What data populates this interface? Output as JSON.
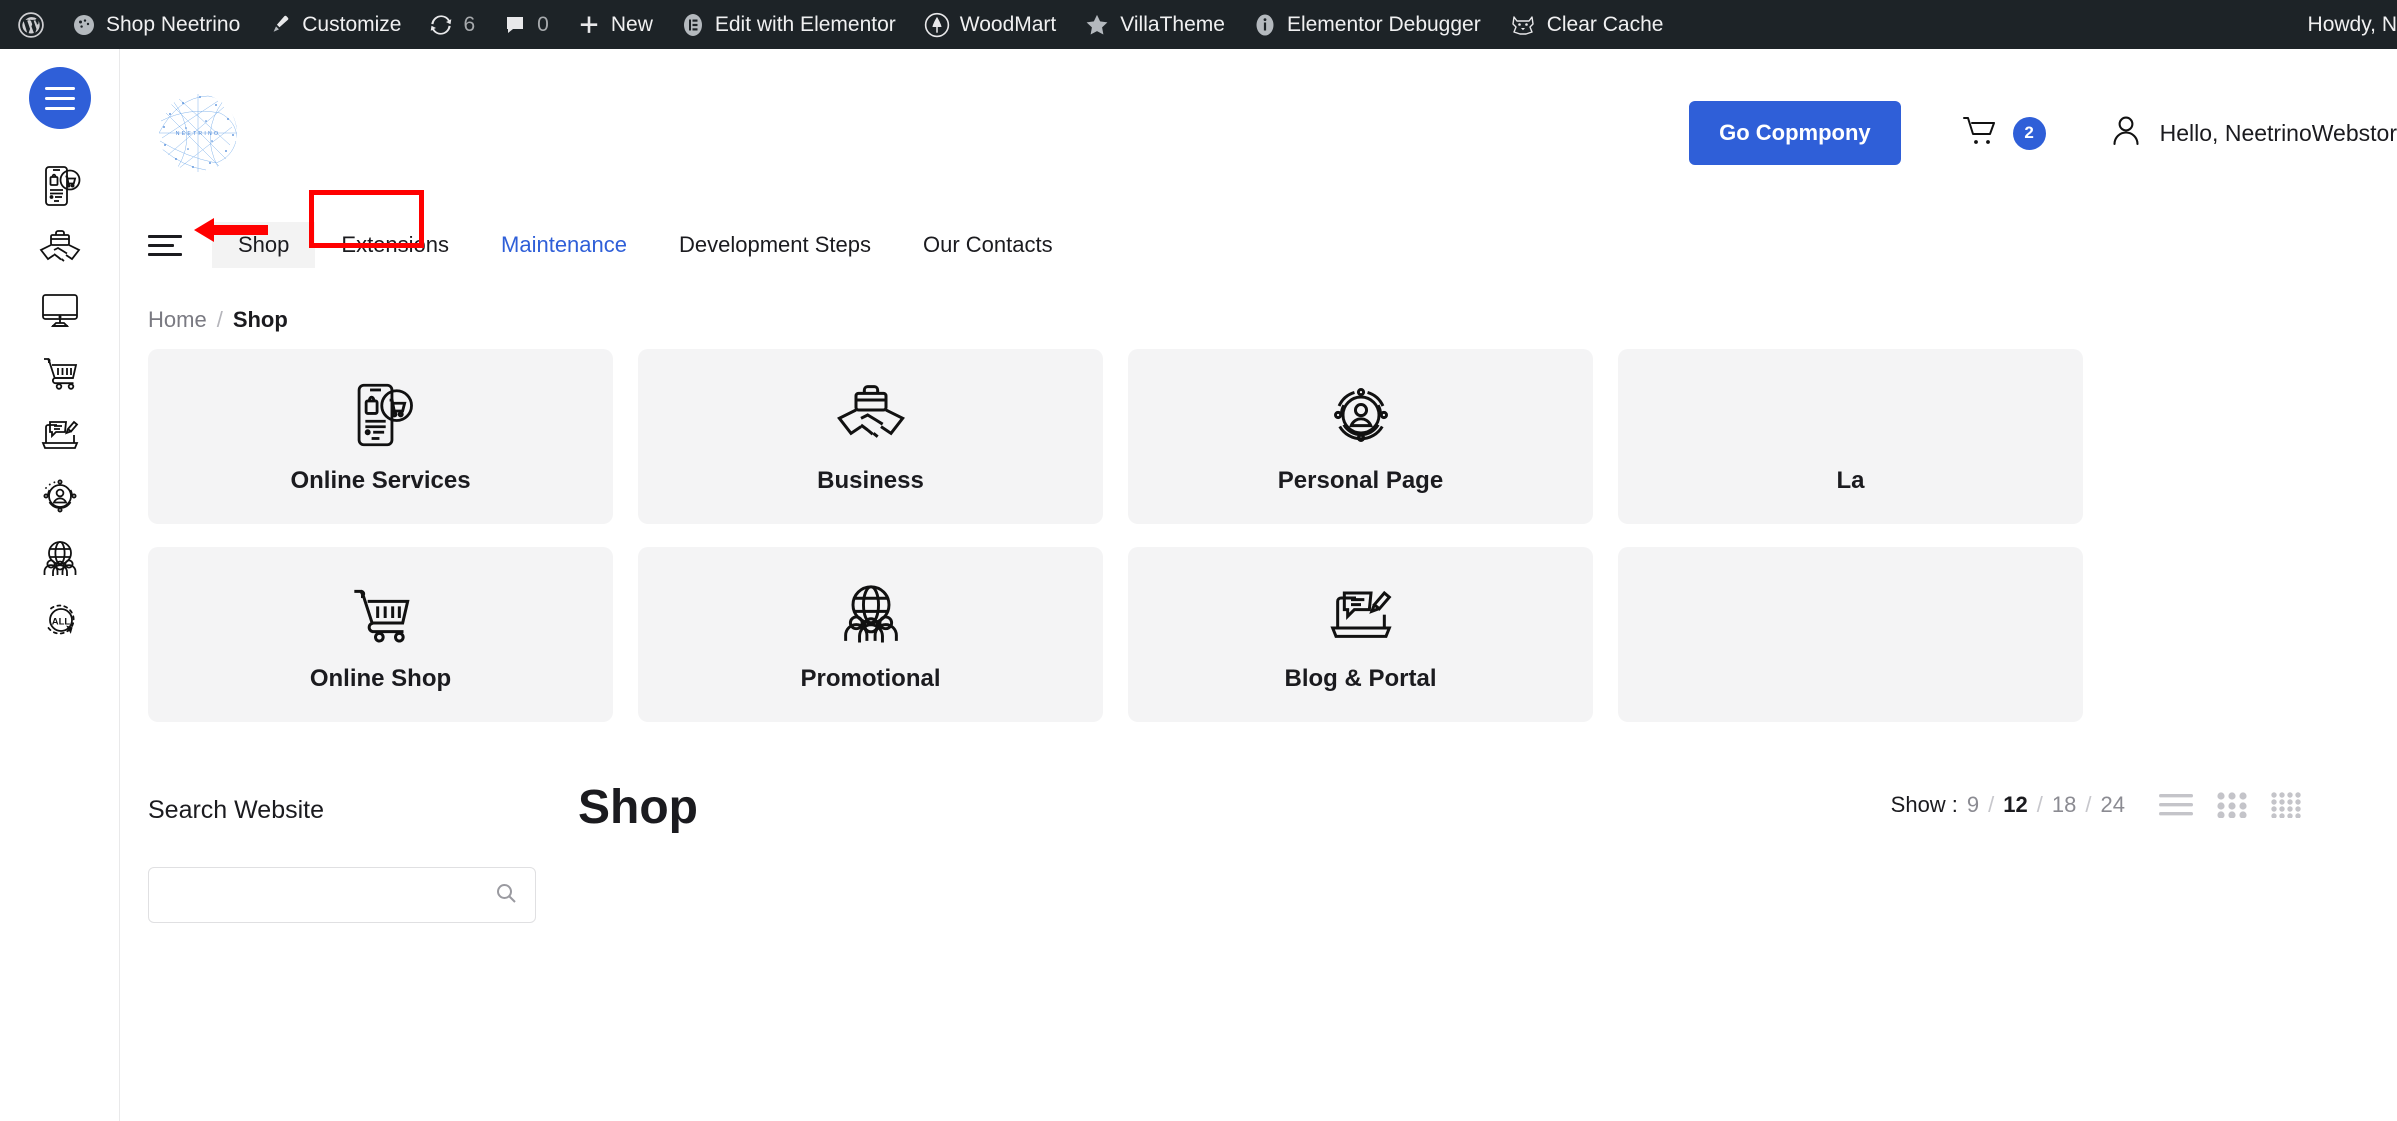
{
  "adminbar": {
    "items": [
      {
        "label": "",
        "icon": "wordpress-logo-icon"
      },
      {
        "label": "Shop Neetrino",
        "icon": "site-dashboard-icon"
      },
      {
        "label": "Customize",
        "icon": "paintbrush-icon"
      },
      {
        "label": "6",
        "icon": "updates-icon"
      },
      {
        "label": "0",
        "icon": "comment-bubble-icon"
      },
      {
        "label": "New",
        "icon": "plus-icon"
      },
      {
        "label": "Edit with Elementor",
        "icon": "elementor-icon"
      },
      {
        "label": "WoodMart",
        "icon": "woodmart-icon"
      },
      {
        "label": "VillaTheme",
        "icon": "star-icon"
      },
      {
        "label": "Elementor Debugger",
        "icon": "info-icon"
      },
      {
        "label": "Clear Cache",
        "icon": "cat-icon"
      }
    ],
    "howdy": "Howdy, N"
  },
  "rail": {
    "menu_toggle_name": "hamburger-menu-button",
    "icons": [
      {
        "name": "mobile-commerce-icon",
        "title": "Online Services"
      },
      {
        "name": "handshake-briefcase-icon",
        "title": "Business"
      },
      {
        "name": "desktop-monitor-icon",
        "title": "Landing"
      },
      {
        "name": "shopping-cart-icon",
        "title": "Online Shop"
      },
      {
        "name": "blog-writing-icon",
        "title": "Blog & Portal"
      },
      {
        "name": "personal-page-icon",
        "title": "Personal Page"
      },
      {
        "name": "global-community-icon",
        "title": "Promotional"
      },
      {
        "name": "all-categories-icon",
        "title": "All"
      }
    ]
  },
  "header": {
    "logo_text": "NEETRINO",
    "cta_label": "Go Copmpony",
    "cart_count": "2",
    "user_greeting": "Hello, NeetrinoWebstor",
    "accent_color": "#2f5fd8"
  },
  "nav": {
    "items": [
      {
        "label": "Shop",
        "state": "active"
      },
      {
        "label": "Extensions",
        "state": "normal"
      },
      {
        "label": "Maintenance",
        "state": "accent"
      },
      {
        "label": "Development Steps",
        "state": "normal"
      },
      {
        "label": "Our Contacts",
        "state": "normal"
      }
    ],
    "annotation_color": "#ff0000"
  },
  "breadcrumb": {
    "home": "Home",
    "separator": "/",
    "current": "Shop"
  },
  "categories": [
    {
      "label": "Online Services",
      "icon": "mobile-commerce-icon"
    },
    {
      "label": "Business",
      "icon": "handshake-briefcase-icon"
    },
    {
      "label": "Personal Page",
      "icon": "personal-page-icon"
    },
    {
      "label": "La",
      "icon": "desktop-monitor-icon"
    },
    {
      "label": "Online Shop",
      "icon": "shopping-cart-icon"
    },
    {
      "label": "Promotional",
      "icon": "global-community-icon"
    },
    {
      "label": "Blog & Portal",
      "icon": "blog-writing-icon"
    },
    {
      "label": "",
      "icon": "blank-icon"
    }
  ],
  "shop": {
    "sidebar_title": "Search Website",
    "search_placeholder": "",
    "search_value": "",
    "title": "Shop",
    "show_label": "Show :",
    "show_options": [
      "9",
      "12",
      "18",
      "24"
    ],
    "show_selected": "12",
    "separator": "/",
    "views": [
      "list-view-icon",
      "grid-3-view-icon",
      "grid-4-view-icon"
    ]
  }
}
